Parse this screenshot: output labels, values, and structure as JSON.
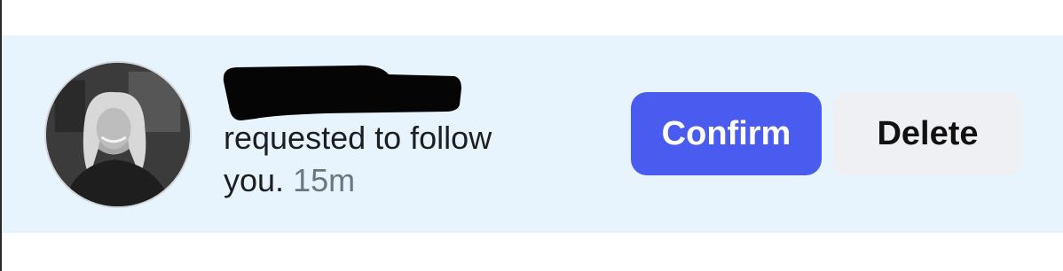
{
  "notification": {
    "message_text": "requested to follow",
    "message_text_line2": "you.",
    "time": "15m",
    "confirm_label": "Confirm",
    "delete_label": "Delete"
  },
  "colors": {
    "row_background": "#e8f4fd",
    "confirm_button": "#4a5cf0",
    "delete_button": "#eef0f3",
    "timestamp": "#6b7680"
  },
  "icons": {
    "avatar": "profile-photo",
    "username": "redacted-username"
  }
}
